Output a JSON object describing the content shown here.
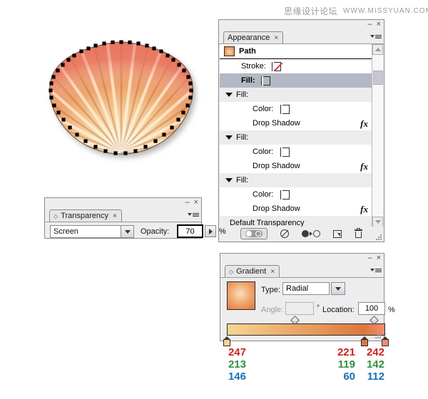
{
  "watermark": {
    "cn": "思缘设计论坛",
    "url": "WWW.MISSYUAN.COM"
  },
  "artwork": {
    "name": "seashell-vector-path",
    "description": "Orange scallop seashell with radial gradient rays and selected anchor points"
  },
  "appearance_panel": {
    "tab_label": "Appearance",
    "tab_close": "×",
    "minimize": "–",
    "close": "×",
    "rows": [
      {
        "name": "path-header",
        "label": "Path",
        "type": "header",
        "swatch": "gradient-orange"
      },
      {
        "name": "stroke-row",
        "label": "Stroke:",
        "type": "attr",
        "swatch": "none"
      },
      {
        "name": "fill-row-selected",
        "label": "Fill:",
        "type": "attr",
        "swatch": "orange",
        "selected": true
      },
      {
        "name": "fill-group-1",
        "label": "Fill:",
        "type": "group"
      },
      {
        "name": "color-row-1",
        "label": "Color:",
        "type": "attr",
        "swatch": "orange"
      },
      {
        "name": "drop-shadow-1",
        "label": "Drop Shadow",
        "type": "effect",
        "fx": "fx"
      },
      {
        "name": "fill-group-2",
        "label": "Fill:",
        "type": "group"
      },
      {
        "name": "color-row-2",
        "label": "Color:",
        "type": "attr",
        "swatch": "orange"
      },
      {
        "name": "drop-shadow-2",
        "label": "Drop Shadow",
        "type": "effect",
        "fx": "fx"
      },
      {
        "name": "fill-group-3",
        "label": "Fill:",
        "type": "group"
      },
      {
        "name": "color-row-3",
        "label": "Color:",
        "type": "attr",
        "swatch": "orange"
      },
      {
        "name": "drop-shadow-3",
        "label": "Drop Shadow",
        "type": "effect",
        "fx": "fx"
      },
      {
        "name": "default-transparency",
        "label": "Default Transparency",
        "type": "footer-row"
      }
    ],
    "footer_buttons": [
      "new-art-maintains-appearance-button",
      "clear-appearance-button",
      "reduce-to-basic-appearance-button",
      "duplicate-selected-item-button",
      "delete-selected-item-button"
    ]
  },
  "transparency_panel": {
    "tab_label": "Transparency",
    "tab_dot": "◇",
    "tab_close": "×",
    "minimize": "–",
    "close": "×",
    "blend_mode": "Screen",
    "opacity_label": "Opacity:",
    "opacity_value": "70",
    "percent": "%"
  },
  "gradient_panel": {
    "tab_label": "Gradient",
    "tab_dot": "◇",
    "tab_close": "×",
    "minimize": "–",
    "close": "×",
    "type_label": "Type:",
    "type_value": "Radial",
    "angle_label": "Angle:",
    "angle_value": "",
    "degree_symbol": "°",
    "location_label": "Location:",
    "location_value": "100",
    "percent": "%",
    "ramp": {
      "stops": [
        {
          "name": "gradient-stop-1",
          "position_pct": 0,
          "color": "#f7d592"
        },
        {
          "name": "gradient-stop-2",
          "position_pct": 87,
          "color": "#dd773c"
        },
        {
          "name": "gradient-stop-3",
          "position_pct": 100,
          "color": "#f28e70"
        }
      ],
      "midpoints": [
        {
          "name": "gradient-midpoint-1",
          "position_pct": 43
        },
        {
          "name": "gradient-midpoint-2",
          "position_pct": 93
        }
      ]
    }
  },
  "rgb_readout": {
    "columns": [
      {
        "name": "rgb-left",
        "r": "247",
        "g": "213",
        "b": "146"
      },
      {
        "name": "rgb-middle",
        "r": "221",
        "g": "119",
        "b": "60"
      },
      {
        "name": "rgb-right",
        "r": "242",
        "g": "142",
        "b": "112"
      }
    ]
  },
  "colors": {
    "panel_bg": "#ededed",
    "panel_border": "#8c8c8c",
    "selection": "#b4b7c4",
    "accent_orange": "#e07c35",
    "r_text": "#cc2222",
    "g_text": "#2f8f3f",
    "b_text": "#1a6fb5"
  }
}
